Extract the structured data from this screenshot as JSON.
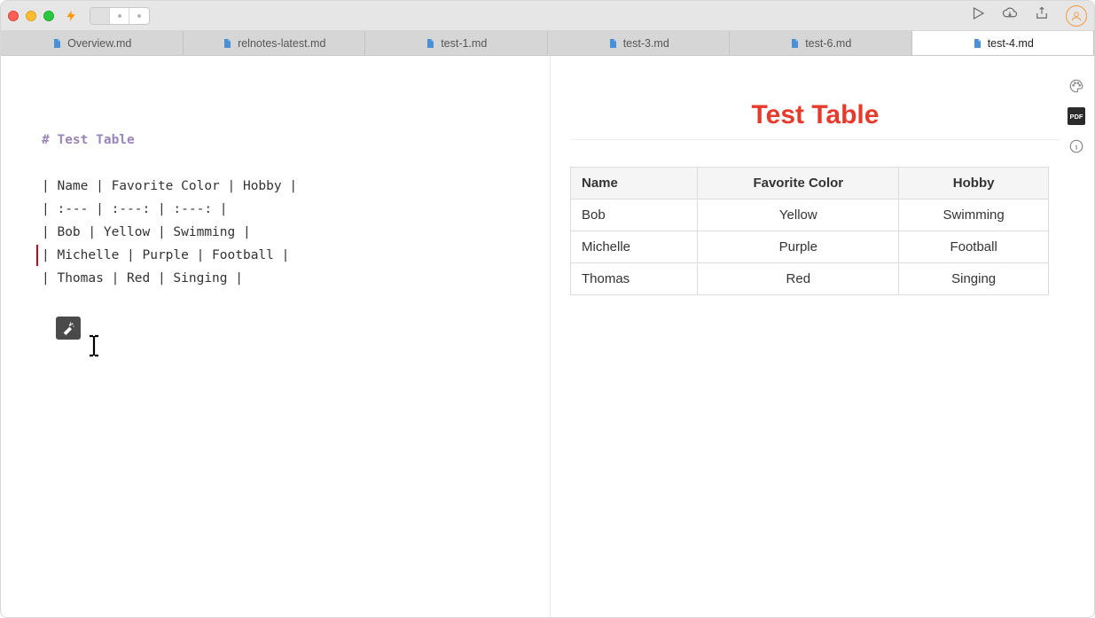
{
  "tabs": [
    {
      "label": "Overview.md",
      "active": false
    },
    {
      "label": "relnotes-latest.md",
      "active": false
    },
    {
      "label": "test-1.md",
      "active": false
    },
    {
      "label": "test-3.md",
      "active": false
    },
    {
      "label": "test-6.md",
      "active": false
    },
    {
      "label": "test-4.md",
      "active": true
    }
  ],
  "editor": {
    "heading": "# Test Table",
    "lines": [
      "| Name | Favorite Color | Hobby |",
      "| :--- | :---: | :---: |",
      "| Bob | Yellow | Swimming |",
      "| Michelle | Purple | Football |",
      "| Thomas | Red | Singing |"
    ],
    "active_line_index": 3
  },
  "preview": {
    "title": "Test Table",
    "columns": [
      "Name",
      "Favorite Color",
      "Hobby"
    ],
    "rows": [
      [
        "Bob",
        "Yellow",
        "Swimming"
      ],
      [
        "Michelle",
        "Purple",
        "Football"
      ],
      [
        "Thomas",
        "Red",
        "Singing"
      ]
    ]
  },
  "side_tools": {
    "pdf_label": "PDF"
  }
}
